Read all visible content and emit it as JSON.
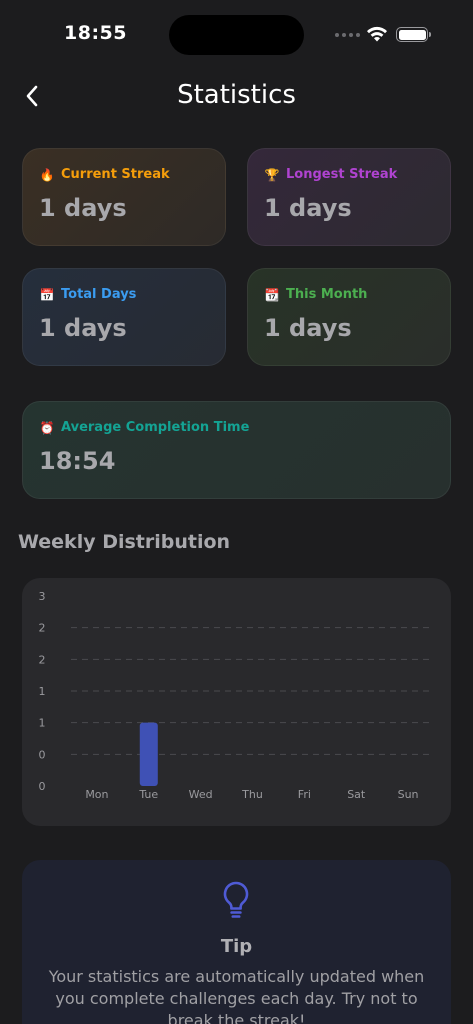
{
  "status_bar": {
    "time": "18:55"
  },
  "header": {
    "title": "Statistics",
    "back_icon": "chevron-left-icon"
  },
  "cards": {
    "current_streak": {
      "emoji": "🔥",
      "label": "Current Streak",
      "value": "1 days",
      "color": "#f59e0b"
    },
    "longest_streak": {
      "emoji": "🏆",
      "label": "Longest Streak",
      "value": "1 days",
      "color": "#b043d1"
    },
    "total_days": {
      "emoji": "📅",
      "label": "Total Days",
      "value": "1 days",
      "color": "#3b9cf0"
    },
    "this_month": {
      "emoji": "📆",
      "label": "This Month",
      "value": "1 days",
      "color": "#4caf50"
    },
    "average_completion": {
      "emoji": "⏰",
      "label": "Average Completion Time",
      "value": "18:54",
      "color": "#14a394"
    }
  },
  "weekly_section": {
    "title": "Weekly Distribution"
  },
  "chart_data": {
    "type": "bar",
    "categories": [
      "Mon",
      "Tue",
      "Wed",
      "Thu",
      "Fri",
      "Sat",
      "Sun"
    ],
    "values": [
      0,
      1,
      0,
      0,
      0,
      0,
      0
    ],
    "ytick_labels": [
      "3",
      "2",
      "2",
      "1",
      "1",
      "0",
      "0"
    ],
    "ylim": [
      0,
      3
    ],
    "grid": true,
    "bar_color": "#3f51b5",
    "title": "",
    "xlabel": "",
    "ylabel": ""
  },
  "tip": {
    "icon": "lightbulb-icon",
    "title": "Tip",
    "body": "Your statistics are automatically updated when you complete challenges each day. Try not to break the streak!",
    "accent": "#4f5bd5"
  }
}
